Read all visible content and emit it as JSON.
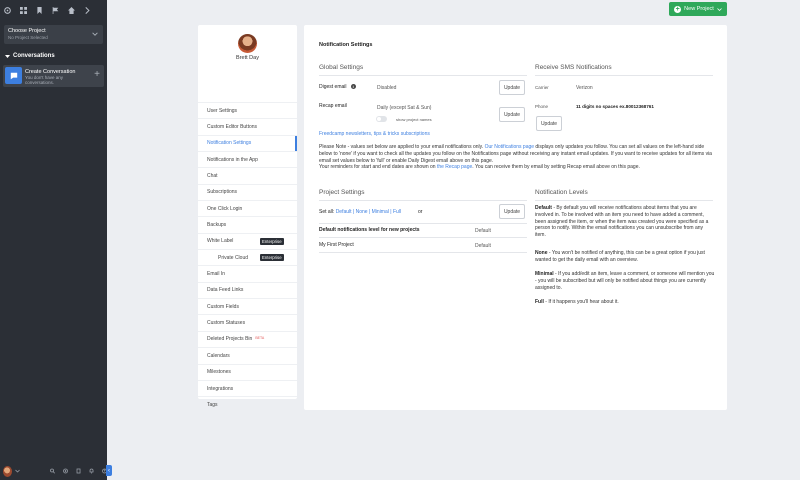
{
  "sidebar": {
    "project_title": "Choose Project",
    "project_subtitle": "No Project Selected",
    "conversations_heading": "Conversations",
    "conversation_card_title": "Create Conversation",
    "conversation_card_text": "You don't have any conversations."
  },
  "header": {
    "new_project": "New Project"
  },
  "user": {
    "name": "Brett Day"
  },
  "menu": {
    "items": [
      "User Settings",
      "Custom Editor Buttons",
      "Notification Settings",
      "Notifications in the App",
      "Chat",
      "Subscriptions",
      "One Click Login",
      "Backups",
      "White Label",
      "Private Cloud",
      "Email In",
      "Data Feed Links",
      "Custom Fields",
      "Custom Statuses",
      "Deleted Projects Bin",
      "Calendars",
      "Milestones",
      "Integrations",
      "Tags"
    ],
    "enterprise_badge": "Enterprise",
    "beta_label": "BETA"
  },
  "panel": {
    "title": "Notification Settings",
    "global_heading": "Global Settings",
    "digest_label": "Digest email",
    "digest_value": "Disabled",
    "recap_label": "Recap email",
    "recap_value": "Daily (except Sat & Sun)",
    "show_project_names": "show project names",
    "update": "Update",
    "newsletter_link": "Freedcamp newsletters, tips & tricks subscriptions",
    "sms_heading": "Receive SMS Notifications",
    "carrier_label": "Carrier",
    "carrier_value": "Verizon",
    "phone_label": "Phone",
    "phone_value": "11 digits no spaces ex.80012368761",
    "note": {
      "p1": "Please Note - values set below are applied to your email notifications only. ",
      "p1_link": "Our Notifications page",
      "p2": " displays only updates you follow. You can set all values on the left-hand side below to 'none' if you want to check all the updates you follow on the Notifications page without receiving any instant email updates. If you want to receive updates for all items via email set values below to 'full' or enable Daily Digest email above on this page.",
      "p3": "Your reminders for start and end dates are shown on ",
      "p3_link": "the Recap page",
      "p4": ". You can receive them by email by setting Recap email above on this page."
    },
    "project_heading": "Project Settings",
    "set_all_label": "Set all:",
    "set_all_options": "Default | None | Minimal | Full",
    "or": "or",
    "default_level_label": "Default notifications level for new projects",
    "default_level_value": "Default",
    "project_name": "My First Project",
    "project_value": "Default",
    "levels_heading": "Notification Levels",
    "levels": {
      "default_title": "Default",
      "default_text": " - By default you will receive notifications about items that you are involved in. To be involved with an item you need to have added a comment, been assigned the item, or when the item was created you were specified as a person to notify. Within the email notifications you can unsubscribe from any item.",
      "none_title": "None",
      "none_text": " - You won't be notified of anything, this can be a great option if you just wanted to get the daily email with an overview.",
      "minimal_title": "Minimal",
      "minimal_text": " - If you add/edit an item, leave a comment, or someone will mention you - you will be subscribed but will only be notified about things you are currently assigned to.",
      "full_title": "Full",
      "full_text": " - If it happens you'll hear about it."
    }
  }
}
